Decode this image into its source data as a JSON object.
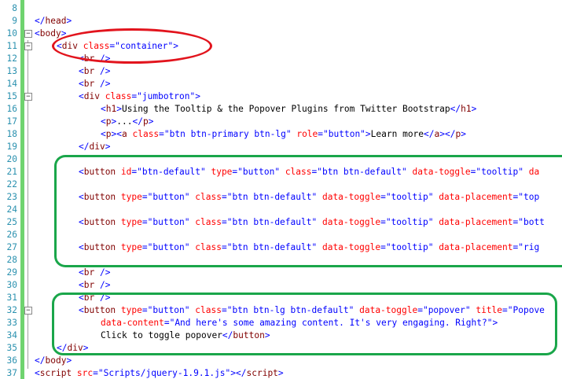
{
  "editor": {
    "lines": [
      {
        "n": "8",
        "fold": "",
        "indent": 0,
        "tokens": []
      },
      {
        "n": "9",
        "fold": "",
        "indent": 0,
        "tokens": [
          [
            "br",
            "</"
          ],
          [
            "tag",
            "head"
          ],
          [
            "br",
            ">"
          ]
        ]
      },
      {
        "n": "10",
        "fold": "−",
        "indent": 0,
        "tokens": [
          [
            "br",
            "<"
          ],
          [
            "tag",
            "body"
          ],
          [
            "br",
            ">"
          ]
        ]
      },
      {
        "n": "11",
        "fold": "−",
        "indent": 1,
        "tokens": [
          [
            "br",
            "<"
          ],
          [
            "tag",
            "div"
          ],
          [
            "txt",
            " "
          ],
          [
            "attr",
            "class"
          ],
          [
            "br",
            "="
          ],
          [
            "val",
            "\"container\""
          ],
          [
            "br",
            ">"
          ]
        ]
      },
      {
        "n": "12",
        "fold": "",
        "indent": 2,
        "tokens": [
          [
            "br",
            "<"
          ],
          [
            "tag",
            "br"
          ],
          [
            "txt",
            " "
          ],
          [
            "br",
            "/>"
          ]
        ]
      },
      {
        "n": "13",
        "fold": "",
        "indent": 2,
        "tokens": [
          [
            "br",
            "<"
          ],
          [
            "tag",
            "br"
          ],
          [
            "txt",
            " "
          ],
          [
            "br",
            "/>"
          ]
        ]
      },
      {
        "n": "14",
        "fold": "",
        "indent": 2,
        "tokens": [
          [
            "br",
            "<"
          ],
          [
            "tag",
            "br"
          ],
          [
            "txt",
            " "
          ],
          [
            "br",
            "/>"
          ]
        ]
      },
      {
        "n": "15",
        "fold": "−",
        "indent": 2,
        "tokens": [
          [
            "br",
            "<"
          ],
          [
            "tag",
            "div"
          ],
          [
            "txt",
            " "
          ],
          [
            "attr",
            "class"
          ],
          [
            "br",
            "="
          ],
          [
            "val",
            "\"jumbotron\""
          ],
          [
            "br",
            ">"
          ]
        ]
      },
      {
        "n": "16",
        "fold": "",
        "indent": 3,
        "tokens": [
          [
            "br",
            "<"
          ],
          [
            "tag",
            "h1"
          ],
          [
            "br",
            ">"
          ],
          [
            "txt",
            "Using the Tooltip & the Popover Plugins from Twitter Bootstrap"
          ],
          [
            "br",
            "</"
          ],
          [
            "tag",
            "h1"
          ],
          [
            "br",
            ">"
          ]
        ]
      },
      {
        "n": "17",
        "fold": "",
        "indent": 3,
        "tokens": [
          [
            "br",
            "<"
          ],
          [
            "tag",
            "p"
          ],
          [
            "br",
            ">"
          ],
          [
            "txt",
            "..."
          ],
          [
            "br",
            "</"
          ],
          [
            "tag",
            "p"
          ],
          [
            "br",
            ">"
          ]
        ]
      },
      {
        "n": "18",
        "fold": "",
        "indent": 3,
        "tokens": [
          [
            "br",
            "<"
          ],
          [
            "tag",
            "p"
          ],
          [
            "br",
            "><"
          ],
          [
            "tag",
            "a"
          ],
          [
            "txt",
            " "
          ],
          [
            "attr",
            "class"
          ],
          [
            "br",
            "="
          ],
          [
            "val",
            "\"btn btn-primary btn-lg\""
          ],
          [
            "txt",
            " "
          ],
          [
            "attr",
            "role"
          ],
          [
            "br",
            "="
          ],
          [
            "val",
            "\"button\""
          ],
          [
            "br",
            ">"
          ],
          [
            "txt",
            "Learn more"
          ],
          [
            "br",
            "</"
          ],
          [
            "tag",
            "a"
          ],
          [
            "br",
            "></"
          ],
          [
            "tag",
            "p"
          ],
          [
            "br",
            ">"
          ]
        ]
      },
      {
        "n": "19",
        "fold": "",
        "indent": 2,
        "tokens": [
          [
            "br",
            "</"
          ],
          [
            "tag",
            "div"
          ],
          [
            "br",
            ">"
          ]
        ]
      },
      {
        "n": "20",
        "fold": "",
        "indent": 0,
        "tokens": []
      },
      {
        "n": "21",
        "fold": "",
        "indent": 2,
        "tokens": [
          [
            "br",
            "<"
          ],
          [
            "tag",
            "button"
          ],
          [
            "txt",
            " "
          ],
          [
            "attr",
            "id"
          ],
          [
            "br",
            "="
          ],
          [
            "val",
            "\"btn-default\""
          ],
          [
            "txt",
            " "
          ],
          [
            "attr",
            "type"
          ],
          [
            "br",
            "="
          ],
          [
            "val",
            "\"button\""
          ],
          [
            "txt",
            " "
          ],
          [
            "attr",
            "class"
          ],
          [
            "br",
            "="
          ],
          [
            "val",
            "\"btn btn-default\""
          ],
          [
            "txt",
            " "
          ],
          [
            "attr",
            "data-toggle"
          ],
          [
            "br",
            "="
          ],
          [
            "val",
            "\"tooltip\""
          ],
          [
            "txt",
            " "
          ],
          [
            "attr",
            "da"
          ]
        ]
      },
      {
        "n": "22",
        "fold": "",
        "indent": 0,
        "tokens": []
      },
      {
        "n": "23",
        "fold": "",
        "indent": 2,
        "tokens": [
          [
            "br",
            "<"
          ],
          [
            "tag",
            "button"
          ],
          [
            "txt",
            " "
          ],
          [
            "attr",
            "type"
          ],
          [
            "br",
            "="
          ],
          [
            "val",
            "\"button\""
          ],
          [
            "txt",
            " "
          ],
          [
            "attr",
            "class"
          ],
          [
            "br",
            "="
          ],
          [
            "val",
            "\"btn btn-default\""
          ],
          [
            "txt",
            " "
          ],
          [
            "attr",
            "data-toggle"
          ],
          [
            "br",
            "="
          ],
          [
            "val",
            "\"tooltip\""
          ],
          [
            "txt",
            " "
          ],
          [
            "attr",
            "data-placement"
          ],
          [
            "br",
            "="
          ],
          [
            "val",
            "\"top"
          ]
        ]
      },
      {
        "n": "24",
        "fold": "",
        "indent": 0,
        "tokens": []
      },
      {
        "n": "25",
        "fold": "",
        "indent": 2,
        "tokens": [
          [
            "br",
            "<"
          ],
          [
            "tag",
            "button"
          ],
          [
            "txt",
            " "
          ],
          [
            "attr",
            "type"
          ],
          [
            "br",
            "="
          ],
          [
            "val",
            "\"button\""
          ],
          [
            "txt",
            " "
          ],
          [
            "attr",
            "class"
          ],
          [
            "br",
            "="
          ],
          [
            "val",
            "\"btn btn-default\""
          ],
          [
            "txt",
            " "
          ],
          [
            "attr",
            "data-toggle"
          ],
          [
            "br",
            "="
          ],
          [
            "val",
            "\"tooltip\""
          ],
          [
            "txt",
            " "
          ],
          [
            "attr",
            "data-placement"
          ],
          [
            "br",
            "="
          ],
          [
            "val",
            "\"bott"
          ]
        ]
      },
      {
        "n": "26",
        "fold": "",
        "indent": 0,
        "tokens": []
      },
      {
        "n": "27",
        "fold": "",
        "indent": 2,
        "tokens": [
          [
            "br",
            "<"
          ],
          [
            "tag",
            "button"
          ],
          [
            "txt",
            " "
          ],
          [
            "attr",
            "type"
          ],
          [
            "br",
            "="
          ],
          [
            "val",
            "\"button\""
          ],
          [
            "txt",
            " "
          ],
          [
            "attr",
            "class"
          ],
          [
            "br",
            "="
          ],
          [
            "val",
            "\"btn btn-default\""
          ],
          [
            "txt",
            " "
          ],
          [
            "attr",
            "data-toggle"
          ],
          [
            "br",
            "="
          ],
          [
            "val",
            "\"tooltip\""
          ],
          [
            "txt",
            " "
          ],
          [
            "attr",
            "data-placement"
          ],
          [
            "br",
            "="
          ],
          [
            "val",
            "\"rig"
          ]
        ]
      },
      {
        "n": "28",
        "fold": "",
        "indent": 0,
        "tokens": []
      },
      {
        "n": "29",
        "fold": "",
        "indent": 2,
        "tokens": [
          [
            "br",
            "<"
          ],
          [
            "tag",
            "br"
          ],
          [
            "txt",
            " "
          ],
          [
            "br",
            "/>"
          ]
        ]
      },
      {
        "n": "30",
        "fold": "",
        "indent": 2,
        "tokens": [
          [
            "br",
            "<"
          ],
          [
            "tag",
            "br"
          ],
          [
            "txt",
            " "
          ],
          [
            "br",
            "/>"
          ]
        ]
      },
      {
        "n": "31",
        "fold": "",
        "indent": 2,
        "tokens": [
          [
            "br",
            "<"
          ],
          [
            "tag",
            "br"
          ],
          [
            "txt",
            " "
          ],
          [
            "br",
            "/>"
          ]
        ]
      },
      {
        "n": "32",
        "fold": "−",
        "indent": 2,
        "tokens": [
          [
            "br",
            "<"
          ],
          [
            "tag",
            "button"
          ],
          [
            "txt",
            " "
          ],
          [
            "attr",
            "type"
          ],
          [
            "br",
            "="
          ],
          [
            "val",
            "\"button\""
          ],
          [
            "txt",
            " "
          ],
          [
            "attr",
            "class"
          ],
          [
            "br",
            "="
          ],
          [
            "val",
            "\"btn btn-lg btn-default\""
          ],
          [
            "txt",
            " "
          ],
          [
            "attr",
            "data-toggle"
          ],
          [
            "br",
            "="
          ],
          [
            "val",
            "\"popover\""
          ],
          [
            "txt",
            " "
          ],
          [
            "attr",
            "title"
          ],
          [
            "br",
            "="
          ],
          [
            "val",
            "\"Popove"
          ]
        ]
      },
      {
        "n": "33",
        "fold": "",
        "indent": 3,
        "tokens": [
          [
            "attr",
            "data-content"
          ],
          [
            "br",
            "="
          ],
          [
            "val",
            "\"And here's some amazing content. It's very engaging. Right?\""
          ],
          [
            "br",
            ">"
          ]
        ]
      },
      {
        "n": "34",
        "fold": "",
        "indent": 3,
        "tokens": [
          [
            "txt",
            "Click to toggle popover"
          ],
          [
            "br",
            "</"
          ],
          [
            "tag",
            "button"
          ],
          [
            "br",
            ">"
          ]
        ]
      },
      {
        "n": "35",
        "fold": "",
        "indent": 1,
        "tokens": [
          [
            "br",
            "</"
          ],
          [
            "tag",
            "div"
          ],
          [
            "br",
            ">"
          ]
        ]
      },
      {
        "n": "36",
        "fold": "",
        "indent": 0,
        "tokens": [
          [
            "br",
            "</"
          ],
          [
            "tag",
            "body"
          ],
          [
            "br",
            ">"
          ]
        ]
      },
      {
        "n": "37",
        "fold": "",
        "indent": 0,
        "tokens": [
          [
            "br",
            "<"
          ],
          [
            "tag",
            "script"
          ],
          [
            "txt",
            " "
          ],
          [
            "attr",
            "src"
          ],
          [
            "br",
            "="
          ],
          [
            "val",
            "\"Scripts/jquery-1.9.1.js\""
          ],
          [
            "br",
            "></"
          ],
          [
            "tag",
            "script"
          ],
          [
            "br",
            ">"
          ]
        ]
      }
    ]
  },
  "annotations": {
    "ellipse_color": "#e2141d",
    "rect_color": "#1aa64a"
  }
}
